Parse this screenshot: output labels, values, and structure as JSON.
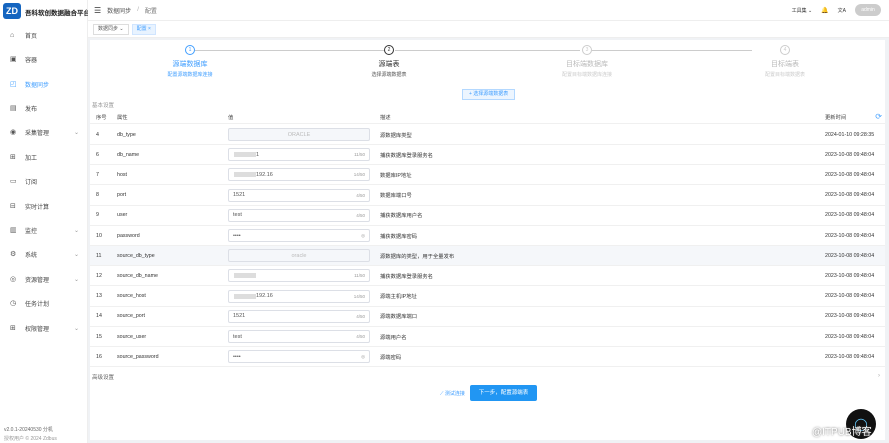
{
  "app": {
    "logo": "ZD",
    "name": "吾科软创数据融合平台"
  },
  "sidebar": {
    "items": [
      {
        "label": "首页",
        "icon": "⌂"
      },
      {
        "label": "容器",
        "icon": "▣"
      },
      {
        "label": "数据同步",
        "icon": "◰",
        "active": true
      },
      {
        "label": "发布",
        "icon": "▤"
      },
      {
        "label": "采集管理",
        "icon": "◉",
        "chev": "⌄"
      },
      {
        "label": "加工",
        "icon": "⊞"
      },
      {
        "label": "订阅",
        "icon": "▭"
      },
      {
        "label": "实时计算",
        "icon": "⊟"
      },
      {
        "label": "监控",
        "icon": "▥",
        "chev": "⌄"
      },
      {
        "label": "系统",
        "icon": "⚙",
        "chev": "⌄"
      },
      {
        "label": "资源管理",
        "icon": "◎",
        "chev": "⌄"
      },
      {
        "label": "任务计划",
        "icon": "◷"
      },
      {
        "label": "权限管理",
        "icon": "⊞",
        "chev": "⌄"
      }
    ],
    "version": "v2.0.1-20240530 分机",
    "copyright": "授权用户 © 2024 Zdbus"
  },
  "header": {
    "menu_icon": "☰",
    "breadcrumb": [
      "数据同步",
      "配置"
    ],
    "tools": "工具集 ⌄",
    "bell": "🔔",
    "lang": "文A",
    "user": "admin"
  },
  "tags": [
    {
      "label": "数据同步 ⌄"
    },
    {
      "label": "配置 ×"
    }
  ],
  "steps": [
    {
      "num": "1",
      "title": "源端数据库",
      "sub": "配置源端数据库连接"
    },
    {
      "num": "2",
      "title": "源端表",
      "sub": "选择源端数据表"
    },
    {
      "num": "3",
      "title": "目标端数据库",
      "sub": "配置目标端数据库连接"
    },
    {
      "num": "4",
      "title": "目标端表",
      "sub": "配置目标端数据表"
    }
  ],
  "select_table_button": "+ 选择源端数据表",
  "basic_section": "基本设置",
  "advanced_section": "高级设置",
  "columns": [
    "序号",
    "属性",
    "值",
    "描述",
    "更新时间"
  ],
  "rows": [
    {
      "no": "4",
      "attr": "db_type",
      "value": "ORACLE",
      "disabled": true,
      "count": "",
      "desc": "源数据库类型",
      "time": "2024-01-10 09:28:35"
    },
    {
      "no": "6",
      "attr": "db_name",
      "value": "1",
      "blur": true,
      "count": "11/50",
      "desc": "捕获数据库登录服务名",
      "time": "2023-10-08 09:48:04"
    },
    {
      "no": "7",
      "attr": "host",
      "value": "192.16",
      "blur": true,
      "count": "14/50",
      "desc": "数据库IP地址",
      "time": "2023-10-08 09:48:04"
    },
    {
      "no": "8",
      "attr": "port",
      "value": "1521",
      "count": "4/50",
      "desc": "数据库端口号",
      "time": "2023-10-08 09:48:04"
    },
    {
      "no": "9",
      "attr": "user",
      "value": "test",
      "count": "4/50",
      "desc": "捕获数据库用户名",
      "time": "2023-10-08 09:48:04"
    },
    {
      "no": "10",
      "attr": "password",
      "value": "••••",
      "eye": true,
      "count": "◎",
      "desc": "捕获数据库密码",
      "time": "2023-10-08 09:48:04"
    },
    {
      "no": "11",
      "attr": "source_db_type",
      "value": "oracle",
      "disabled": true,
      "count": "",
      "desc": "源数据库的类型，用于全量发布",
      "time": "2023-10-08 09:48:04",
      "hl": true
    },
    {
      "no": "12",
      "attr": "source_db_name",
      "value": "",
      "blur": true,
      "count": "11/50",
      "desc": "捕获数据库登录服务名",
      "time": "2023-10-08 09:48:04"
    },
    {
      "no": "13",
      "attr": "source_host",
      "value": "192.16",
      "blur": true,
      "count": "14/50",
      "desc": "源端主机IP地址",
      "time": "2023-10-08 09:48:04"
    },
    {
      "no": "14",
      "attr": "source_port",
      "value": "1521",
      "count": "4/50",
      "desc": "源端数据库端口",
      "time": "2023-10-08 09:48:04"
    },
    {
      "no": "15",
      "attr": "source_user",
      "value": "test",
      "count": "4/50",
      "desc": "源端用户名",
      "time": "2023-10-08 09:48:04"
    },
    {
      "no": "16",
      "attr": "source_password",
      "value": "••••",
      "eye": true,
      "count": "◎",
      "desc": "源端密码",
      "time": "2023-10-08 09:48:04"
    }
  ],
  "actions": {
    "test": "⟋ 测试连接",
    "next": "下一步，配置源端表"
  },
  "watermark": "@ITPUB博客"
}
